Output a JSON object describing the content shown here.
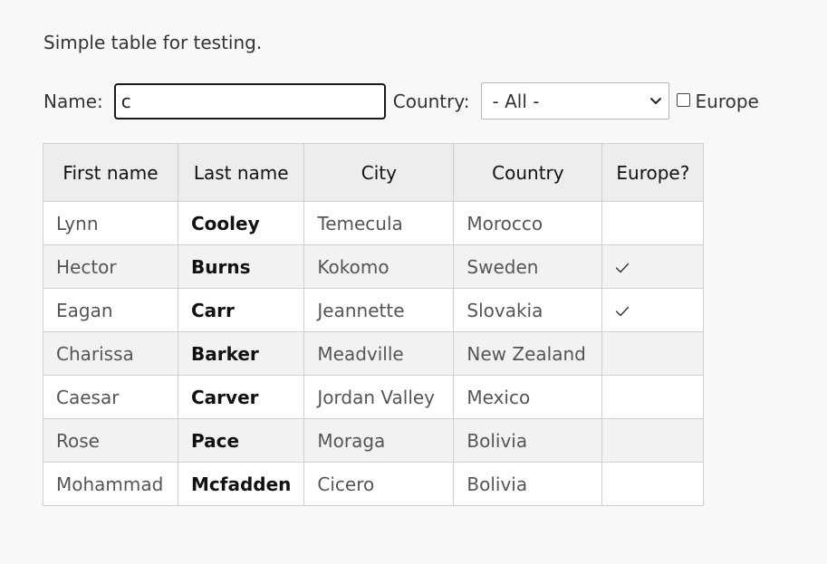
{
  "intro": "Simple table for testing.",
  "filters": {
    "name_label": "Name:",
    "name_value": "c",
    "country_label": "Country:",
    "country_selected": "- All -",
    "europe_label": "Europe",
    "europe_checked": false
  },
  "table": {
    "headers": [
      "First name",
      "Last name",
      "City",
      "Country",
      "Europe?"
    ],
    "rows": [
      {
        "first": "Lynn",
        "last": "Cooley",
        "city": "Temecula",
        "country": "Morocco",
        "europe": false
      },
      {
        "first": "Hector",
        "last": "Burns",
        "city": "Kokomo",
        "country": "Sweden",
        "europe": true
      },
      {
        "first": "Eagan",
        "last": "Carr",
        "city": "Jeannette",
        "country": "Slovakia",
        "europe": true
      },
      {
        "first": "Charissa",
        "last": "Barker",
        "city": "Meadville",
        "country": "New Zealand",
        "europe": false
      },
      {
        "first": "Caesar",
        "last": "Carver",
        "city": "Jordan Valley",
        "country": "Mexico",
        "europe": false
      },
      {
        "first": "Rose",
        "last": "Pace",
        "city": "Moraga",
        "country": "Bolivia",
        "europe": false
      },
      {
        "first": "Mohammad",
        "last": "Mcfadden",
        "city": "Cicero",
        "country": "Bolivia",
        "europe": false
      }
    ]
  },
  "icons": {
    "select_arrow": "chevron-down-icon",
    "europe_mark": "checkmark-icon"
  },
  "colors": {
    "background": "#f8f8f6",
    "header_bg": "#ededed",
    "stripe_bg": "#f2f2f1",
    "focus_border": "#1a1a1a"
  }
}
